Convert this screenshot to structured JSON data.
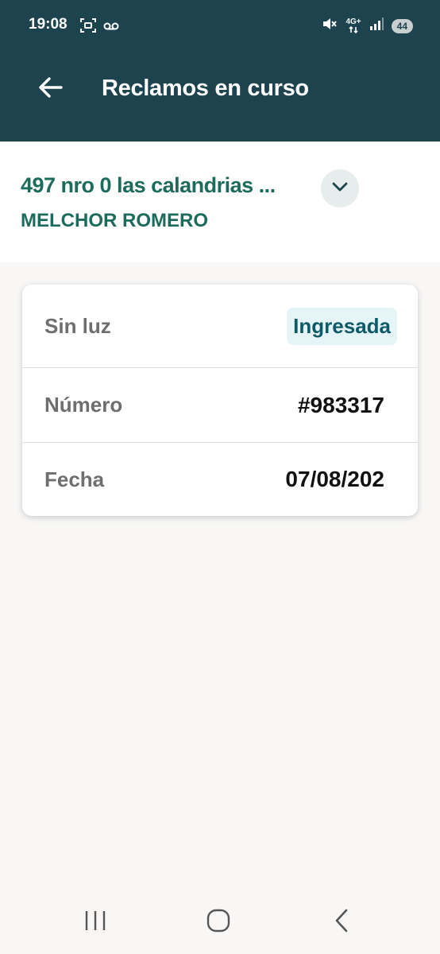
{
  "status_bar": {
    "time": "19:08",
    "network": "4G+",
    "battery": "44",
    "icons": [
      "screenshot-icon",
      "voicemail-icon",
      "mute-icon",
      "network-4g-icon",
      "signal-icon",
      "battery-icon"
    ]
  },
  "app_bar": {
    "title": "Reclamos en curso",
    "back_icon": "arrow-left-icon"
  },
  "address": {
    "line": "497 nro 0 las calandrias ...",
    "locality": "MELCHOR ROMERO",
    "expand_icon": "chevron-down-icon"
  },
  "claim": {
    "type": "Sin luz",
    "status": "Ingresada",
    "number_label": "Número",
    "number_value": "#983317",
    "date_label": "Fecha",
    "date_value": "07/08/202"
  },
  "nav": {
    "icons": [
      "recents-icon",
      "home-icon",
      "back-icon"
    ]
  },
  "colors": {
    "header_bg": "#1c434e",
    "accent_green": "#1d6b5c",
    "chip_bg": "#e5f5f7",
    "chip_text": "#0e5a66",
    "page_bg": "#f8f7f6"
  }
}
